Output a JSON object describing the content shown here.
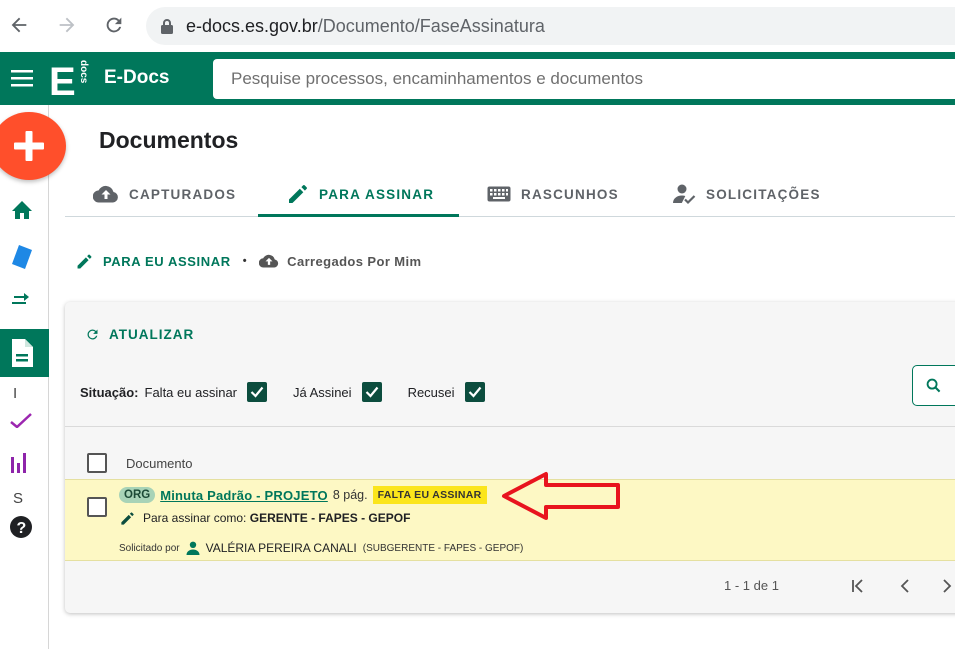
{
  "browser": {
    "url_domain": "e-docs.es.gov.br",
    "url_path": "/Documento/FaseAssinatura"
  },
  "app": {
    "logo_letter": "E",
    "logo_side_text": "docs",
    "brand": "E-Docs",
    "search_placeholder": "Pesquise processos, encaminhamentos e documentos"
  },
  "rail": {
    "letters": [
      "I",
      "S"
    ]
  },
  "page": {
    "title": "Documentos",
    "tabs": [
      {
        "label": "CAPTURADOS",
        "icon": "cloud-upload-icon",
        "active": false
      },
      {
        "label": "PARA ASSINAR",
        "icon": "pencil-icon",
        "active": true
      },
      {
        "label": "RASCUNHOS",
        "icon": "keyboard-icon",
        "active": false
      },
      {
        "label": "SOLICITAÇÕES",
        "icon": "user-check-icon",
        "active": false
      }
    ],
    "sub_nav": {
      "primary": "PARA EU ASSINAR",
      "separator": "•",
      "secondary": "Carregados Por Mim"
    }
  },
  "card": {
    "refresh_label": "ATUALIZAR",
    "situacao_label": "Situação:",
    "filters": [
      {
        "label": "Falta eu assinar",
        "checked": true
      },
      {
        "label": "Já Assinei",
        "checked": true
      },
      {
        "label": "Recusei",
        "checked": true
      }
    ],
    "column_document": "Documento",
    "rows": [
      {
        "badge": "ORG",
        "title": "Minuta Padrão - PROJETO",
        "pages": "8 pág.",
        "status": "FALTA EU ASSINAR",
        "sign_as_label": "Para assinar como:",
        "sign_as_value": "GERENTE - FAPES - GEPOF",
        "requested_label": "Solicitado por",
        "requester_name": "VALÉRIA PEREIRA CANALI",
        "requester_role": "(SUBGERENTE - FAPES - GEPOF)"
      }
    ],
    "pagination": "1 - 1 de 1"
  },
  "colors": {
    "primary": "#00775b",
    "fab": "#ff4f2b",
    "row_highlight": "#fdf8c4",
    "status_badge": "#fbe51b",
    "annotation_arrow": "#e8141e"
  }
}
